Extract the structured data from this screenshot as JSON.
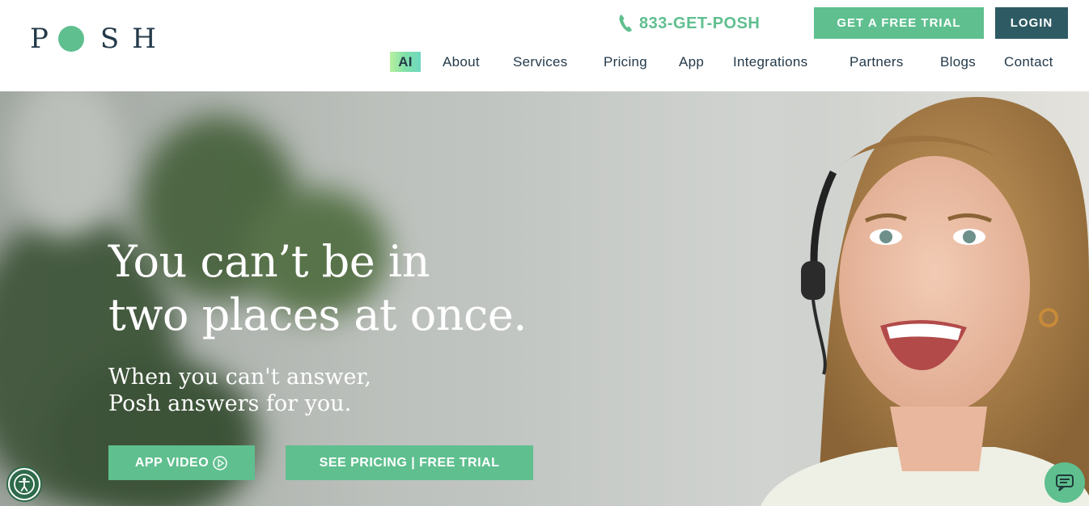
{
  "header": {
    "logo": {
      "letters": [
        "P",
        "S",
        "H"
      ],
      "alt": "POSH"
    },
    "phone": "833-GET-POSH",
    "trial_button": "GET A FREE TRIAL",
    "login_button": "LOGIN"
  },
  "nav": {
    "items": [
      "AI",
      "About",
      "Services",
      "Pricing",
      "App",
      "Integrations",
      "Partners",
      "Blogs",
      "Contact"
    ]
  },
  "hero": {
    "headline_line1": "You can’t be in",
    "headline_line2": "two places at once.",
    "subhead_line1": "When you can't answer,",
    "subhead_line2": "Posh answers for you.",
    "video_button": "APP VIDEO",
    "pricing_button": "SEE PRICING | FREE TRIAL"
  },
  "icons": {
    "phone": "phone-icon",
    "play": "play-circle-icon",
    "accessibility": "accessibility-icon",
    "chat": "chat-icon"
  },
  "colors": {
    "accent_green": "#5fbf8f",
    "dark_teal": "#2e5a63",
    "navy_text": "#243a4a"
  }
}
